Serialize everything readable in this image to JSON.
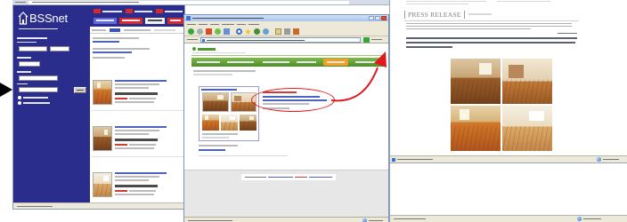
{
  "bssnet_window": {
    "logo_text": "BSSnet"
  },
  "press_window": {
    "heading": "PRESS RELEASE"
  },
  "colors": {
    "bssnet_navy": "#2b2d8c",
    "highlight_red": "#e0191e",
    "nav_green": "#4f8d26",
    "nav_orange": "#f2a01e",
    "link_blue": "#4d63c0",
    "pointer_black": "#000000"
  },
  "icons": {
    "pointer": "pointer-arrow-icon",
    "logo": "house-logo-icon",
    "highlight": "red-ellipse-highlight",
    "connector": "red-curved-arrow",
    "status": "globe-icon",
    "toolbar": [
      "back-icon",
      "forward-icon",
      "stop-icon",
      "refresh-icon",
      "home-icon",
      "search-icon",
      "favorites-star-icon",
      "media-icon",
      "history-icon",
      "mail-icon",
      "print-icon",
      "edit-icon"
    ]
  }
}
